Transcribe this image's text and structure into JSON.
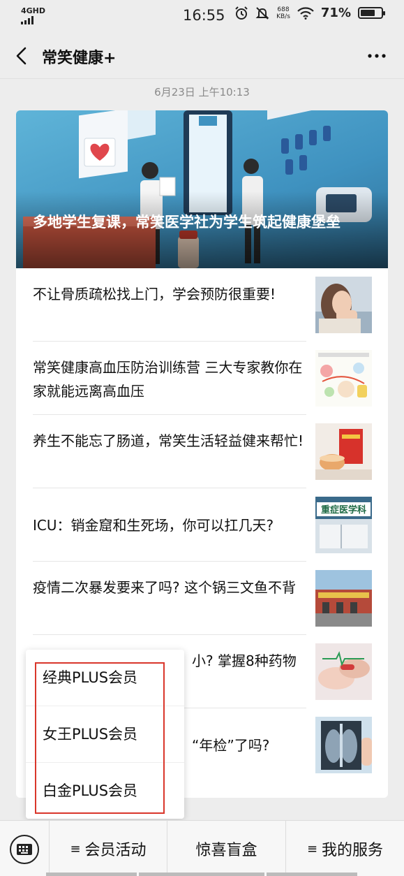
{
  "status_bar": {
    "network": "4GHD",
    "time": "16:55",
    "speed_value": "688",
    "speed_unit": "KB/s",
    "battery_pct": "71%",
    "battery_level": 0.71
  },
  "nav": {
    "title": "常笑健康+"
  },
  "timestamp": "6月23日 上午10:13",
  "hero": {
    "title": "多地学生复课，常笑医学社为学生筑起健康堡垒"
  },
  "articles": [
    {
      "title": "不让骨质疏松找上门，学会预防很重要!"
    },
    {
      "title": "常笑健康高血压防治训练营 三大专家教你在家就能远离高血压"
    },
    {
      "title": "养生不能忘了肠道，常笑生活轻益健来帮忙!"
    },
    {
      "title": "ICU：销金窟和生死场，你可以扛几天?"
    },
    {
      "title": "疫情二次暴发要来了吗? 这个锅三文鱼不背"
    },
    {
      "title": "小? 掌握8种药物"
    },
    {
      "title": "“年检”了吗?"
    }
  ],
  "thumbs": {
    "icu_sign": "重症医学科"
  },
  "popup": {
    "items": [
      {
        "label": "经典PLUS会员"
      },
      {
        "label": "女王PLUS会员"
      },
      {
        "label": "白金PLUS会员"
      }
    ]
  },
  "bottom_menu": {
    "items": [
      {
        "label": "会员活动",
        "has_list_icon": true
      },
      {
        "label": "惊喜盲盒",
        "has_list_icon": false
      },
      {
        "label": "我的服务",
        "has_list_icon": true
      }
    ]
  },
  "colors": {
    "highlight": "#d9362b",
    "hero_blue": "#3f92c0",
    "background": "#ededed"
  }
}
